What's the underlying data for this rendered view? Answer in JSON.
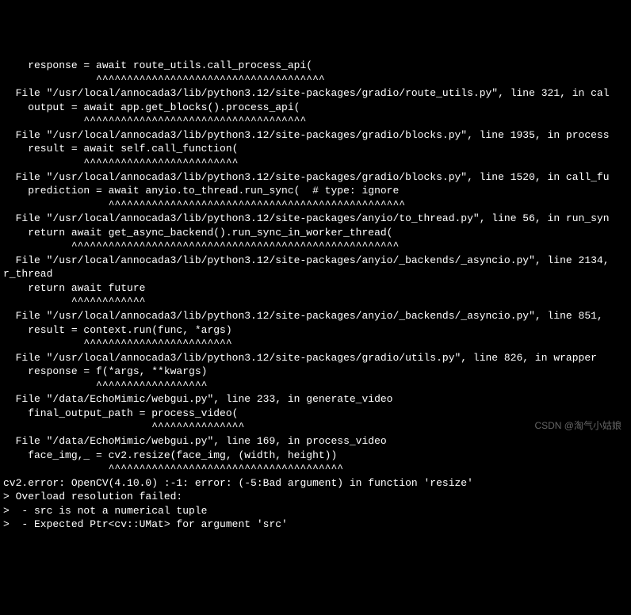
{
  "terminal": {
    "lines": [
      "    response = await route_utils.call_process_api(",
      "               ^^^^^^^^^^^^^^^^^^^^^^^^^^^^^^^^^^^^^",
      "  File \"/usr/local/annocada3/lib/python3.12/site-packages/gradio/route_utils.py\", line 321, in cal",
      "    output = await app.get_blocks().process_api(",
      "             ^^^^^^^^^^^^^^^^^^^^^^^^^^^^^^^^^^^^",
      "  File \"/usr/local/annocada3/lib/python3.12/site-packages/gradio/blocks.py\", line 1935, in process",
      "    result = await self.call_function(",
      "             ^^^^^^^^^^^^^^^^^^^^^^^^^",
      "  File \"/usr/local/annocada3/lib/python3.12/site-packages/gradio/blocks.py\", line 1520, in call_fu",
      "    prediction = await anyio.to_thread.run_sync(  # type: ignore",
      "                 ^^^^^^^^^^^^^^^^^^^^^^^^^^^^^^^^^^^^^^^^^^^^^^^^",
      "  File \"/usr/local/annocada3/lib/python3.12/site-packages/anyio/to_thread.py\", line 56, in run_syn",
      "    return await get_async_backend().run_sync_in_worker_thread(",
      "           ^^^^^^^^^^^^^^^^^^^^^^^^^^^^^^^^^^^^^^^^^^^^^^^^^^^^^",
      "  File \"/usr/local/annocada3/lib/python3.12/site-packages/anyio/_backends/_asyncio.py\", line 2134,",
      "r_thread",
      "    return await future",
      "           ^^^^^^^^^^^^",
      "  File \"/usr/local/annocada3/lib/python3.12/site-packages/anyio/_backends/_asyncio.py\", line 851, ",
      "    result = context.run(func, *args)",
      "             ^^^^^^^^^^^^^^^^^^^^^^^^",
      "  File \"/usr/local/annocada3/lib/python3.12/site-packages/gradio/utils.py\", line 826, in wrapper",
      "    response = f(*args, **kwargs)",
      "               ^^^^^^^^^^^^^^^^^^",
      "  File \"/data/EchoMimic/webgui.py\", line 233, in generate_video",
      "    final_output_path = process_video(",
      "                        ^^^^^^^^^^^^^^^",
      "  File \"/data/EchoMimic/webgui.py\", line 169, in process_video",
      "    face_img,_ = cv2.resize(face_img, (width, height))",
      "                 ^^^^^^^^^^^^^^^^^^^^^^^^^^^^^^^^^^^^^^",
      "cv2.error: OpenCV(4.10.0) :-1: error: (-5:Bad argument) in function 'resize'",
      "> Overload resolution failed:",
      ">  - src is not a numerical tuple",
      ">  - Expected Ptr<cv::UMat> for argument 'src'",
      ""
    ]
  },
  "watermark": {
    "text": "CSDN @淘气小姑娘"
  }
}
